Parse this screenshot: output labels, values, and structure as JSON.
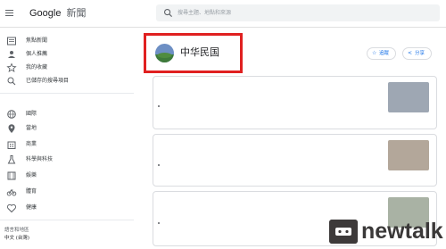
{
  "header": {
    "logo_google": "Google",
    "logo_suffix": "新聞",
    "search_placeholder": "搜尋主題、地點和來源"
  },
  "sidebar": {
    "items": [
      {
        "label": "焦點新聞",
        "icon": "newspaper-icon"
      },
      {
        "label": "個人推薦",
        "icon": "person-icon"
      },
      {
        "label": "我的收藏",
        "icon": "star-icon"
      },
      {
        "label": "已儲存的搜尋項目",
        "icon": "saved-search-icon"
      },
      {
        "label": "國際",
        "icon": "globe-icon"
      },
      {
        "label": "當地",
        "icon": "location-pin-icon"
      },
      {
        "label": "商業",
        "icon": "building-icon"
      },
      {
        "label": "科學與科技",
        "icon": "flask-icon"
      },
      {
        "label": "娛樂",
        "icon": "film-icon"
      },
      {
        "label": "體育",
        "icon": "bike-icon"
      },
      {
        "label": "健康",
        "icon": "health-icon"
      }
    ],
    "language_label": "語言和地區",
    "language_value": "中文 (台灣)"
  },
  "topic": {
    "title": "中华民国",
    "follow_label": "追蹤",
    "share_label": "分享"
  },
  "articles": [
    {
      "headline": "",
      "source": "",
      "sub_title": "",
      "sub_source": "",
      "more_label": ""
    },
    {
      "headline": "",
      "source": "",
      "sub_title": "",
      "sub_source": "",
      "more_label": ""
    },
    {
      "headline": "",
      "source": "",
      "sub_title": "",
      "sub_source": "",
      "more_label": ""
    }
  ],
  "watermark": {
    "text": "newtalk"
  },
  "colors": {
    "accent": "#1a73e8",
    "highlight_frame": "#e02020",
    "watermark": "#3a3838"
  }
}
